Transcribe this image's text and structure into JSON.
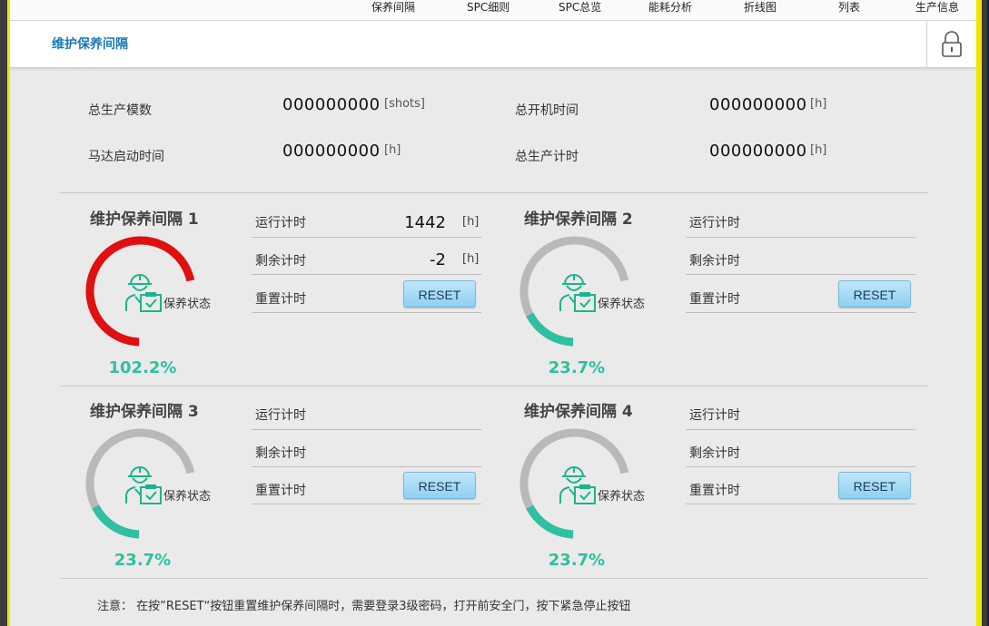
{
  "nav": {
    "items": [
      "保养间隔",
      "SPC细则",
      "SPC总览",
      "能耗分析",
      "折线图",
      "列表",
      "生产信息"
    ]
  },
  "header": {
    "title": "维护保养间隔"
  },
  "summary": {
    "items": [
      {
        "label": "总生产模数",
        "value": "000000000",
        "unit": "[shots]"
      },
      {
        "label": "总开机时间",
        "value": "000000000",
        "unit": "[h]"
      },
      {
        "label": "马达启动时间",
        "value": "000000000",
        "unit": "[h]"
      },
      {
        "label": "总生产计时",
        "value": "000000000",
        "unit": "[h]"
      }
    ]
  },
  "panels": [
    {
      "title": "维护保养间隔 1",
      "status_label": "保养状态",
      "percent_text": "102.2%",
      "percent": 102.2,
      "gauge_color": "#e01010",
      "rows": {
        "run_label": "运行计时",
        "run_value": "1442",
        "run_unit": "[h]",
        "remain_label": "剩余计时",
        "remain_value": "-2",
        "remain_unit": "[h]",
        "reset_label": "重置计时",
        "reset_button": "RESET"
      }
    },
    {
      "title": "维护保养间隔 2",
      "status_label": "保养状态",
      "percent_text": "23.7%",
      "percent": 23.7,
      "gauge_color": "#2ec0a0",
      "rows": {
        "run_label": "运行计时",
        "remain_label": "剩余计时",
        "reset_label": "重置计时",
        "reset_button": "RESET"
      }
    },
    {
      "title": "维护保养间隔 3",
      "status_label": "保养状态",
      "percent_text": "23.7%",
      "percent": 23.7,
      "gauge_color": "#2ec0a0",
      "rows": {
        "run_label": "运行计时",
        "remain_label": "剩余计时",
        "reset_label": "重置计时",
        "reset_button": "RESET"
      }
    },
    {
      "title": "维护保养间隔 4",
      "status_label": "保养状态",
      "percent_text": "23.7%",
      "percent": 23.7,
      "gauge_color": "#2ec0a0",
      "rows": {
        "run_label": "运行计时",
        "remain_label": "剩余计时",
        "reset_label": "重置计时",
        "reset_button": "RESET"
      }
    }
  ],
  "note": "注意： 在按”RESET“按钮重置维护保养间隔时，需要登录3级密码，打开前安全门，按下紧急停止按钮",
  "colors": {
    "accent_title": "#1a7ab8",
    "gauge_track": "#b9b9b9",
    "gauge_ok": "#2ec0a0",
    "gauge_over": "#e01010",
    "icon": "#1cb38e",
    "window_border": "#f2e600"
  },
  "icons": {
    "lock": "lock-icon",
    "worker": "worker-checklist-icon"
  }
}
